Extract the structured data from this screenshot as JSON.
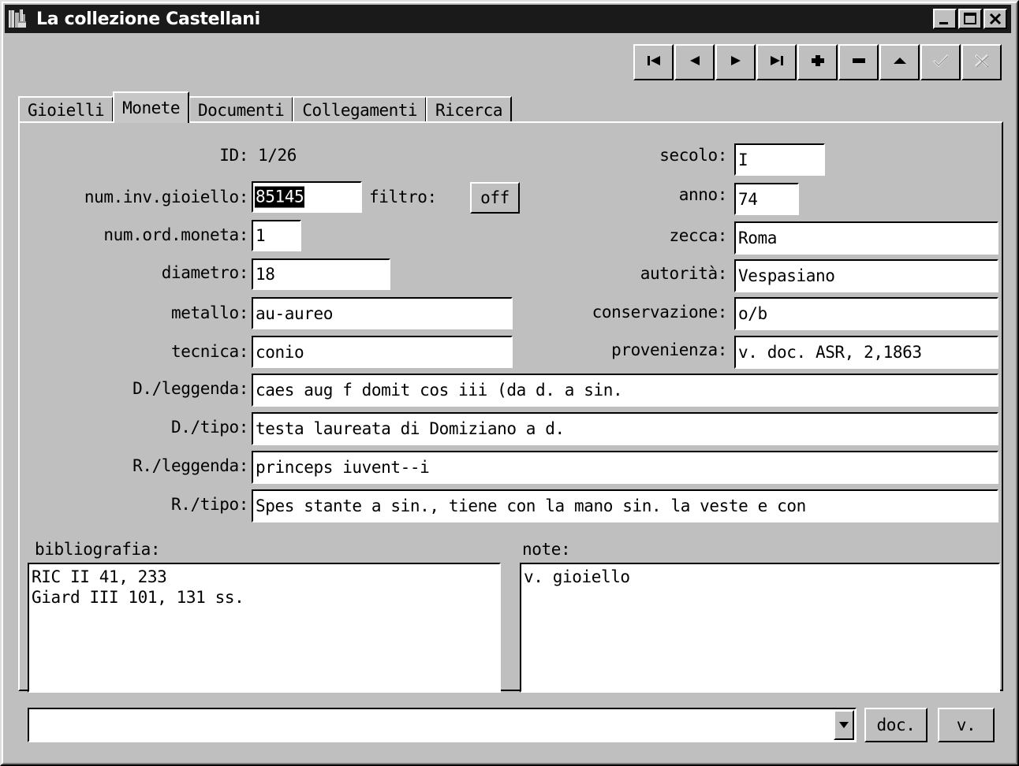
{
  "window": {
    "title": "La collezione Castellani",
    "icon": "buildings-icon",
    "minimize_label": "_",
    "maximize_label": "□",
    "close_label": "✕"
  },
  "navigator": {
    "buttons": [
      {
        "name": "first-record-button",
        "icon": "skip-to-start-icon",
        "enabled": true
      },
      {
        "name": "prior-record-button",
        "icon": "triangle-left-icon",
        "enabled": true
      },
      {
        "name": "next-record-button",
        "icon": "triangle-right-icon",
        "enabled": true
      },
      {
        "name": "last-record-button",
        "icon": "skip-to-end-icon",
        "enabled": true
      },
      {
        "name": "insert-record-button",
        "icon": "plus-icon",
        "enabled": true
      },
      {
        "name": "delete-record-button",
        "icon": "minus-icon",
        "enabled": true
      },
      {
        "name": "edit-record-button",
        "icon": "triangle-up-icon",
        "enabled": true
      },
      {
        "name": "post-record-button",
        "icon": "checkmark-icon",
        "enabled": false
      },
      {
        "name": "cancel-record-button",
        "icon": "cross-icon",
        "enabled": false
      }
    ]
  },
  "tabs": [
    {
      "label": "Gioielli",
      "active": false
    },
    {
      "label": "Monete",
      "active": true
    },
    {
      "label": "Documenti",
      "active": false
    },
    {
      "label": "Collegamenti",
      "active": false
    },
    {
      "label": "Ricerca",
      "active": false
    }
  ],
  "form": {
    "id_label": "ID:",
    "id_value": "1/26",
    "left_fields": [
      {
        "label": "num.inv.gioiello:",
        "value": "85145",
        "selected": true
      },
      {
        "label": "num.ord.moneta:",
        "value": "1",
        "selected": false
      },
      {
        "label": "diametro:",
        "value": "18",
        "selected": false
      },
      {
        "label": "metallo:",
        "value": "au-aureo",
        "selected": false
      },
      {
        "label": "tecnica:",
        "value": "conio",
        "selected": false
      }
    ],
    "filtro_label": "filtro:",
    "filtro_value": "off",
    "right_fields": [
      {
        "label": "secolo:",
        "value": "I"
      },
      {
        "label": "anno:",
        "value": "74"
      },
      {
        "label": "zecca:",
        "value": "Roma"
      },
      {
        "label": "autorità:",
        "value": "Vespasiano"
      },
      {
        "label": "conservazione:",
        "value": "o/b"
      },
      {
        "label": "provenienza:",
        "value": "v. doc. ASR, 2,1863"
      }
    ],
    "wide_fields": [
      {
        "label": "D./leggenda:",
        "value": "caes aug f domit cos iii (da d. a sin."
      },
      {
        "label": "D./tipo:",
        "value": "testa laureata di Domiziano a d."
      },
      {
        "label": "R./leggenda:",
        "value": "princeps iuvent--i"
      },
      {
        "label": "R./tipo:",
        "value": "Spes stante a sin., tiene con la mano sin. la veste e con"
      }
    ],
    "bibliografia_label": "bibliografia:",
    "bibliografia_lines": [
      "RIC II 41, 233",
      "Giard III 101, 131 ss."
    ],
    "note_label": "note:",
    "note_lines": [
      "v. gioiello"
    ]
  },
  "footer": {
    "combo_value": "",
    "combo_placeholder": "",
    "doc_button_label": "doc.",
    "v_button_label": "v."
  },
  "colors": {
    "window_face": "#bfbfbf",
    "titlebar": "#1a1a1a",
    "titlebar_text": "#ffffff",
    "field_bg": "#ffffff",
    "selection_bg": "#000000",
    "selection_fg": "#ffffff",
    "desktop": "#808080"
  }
}
